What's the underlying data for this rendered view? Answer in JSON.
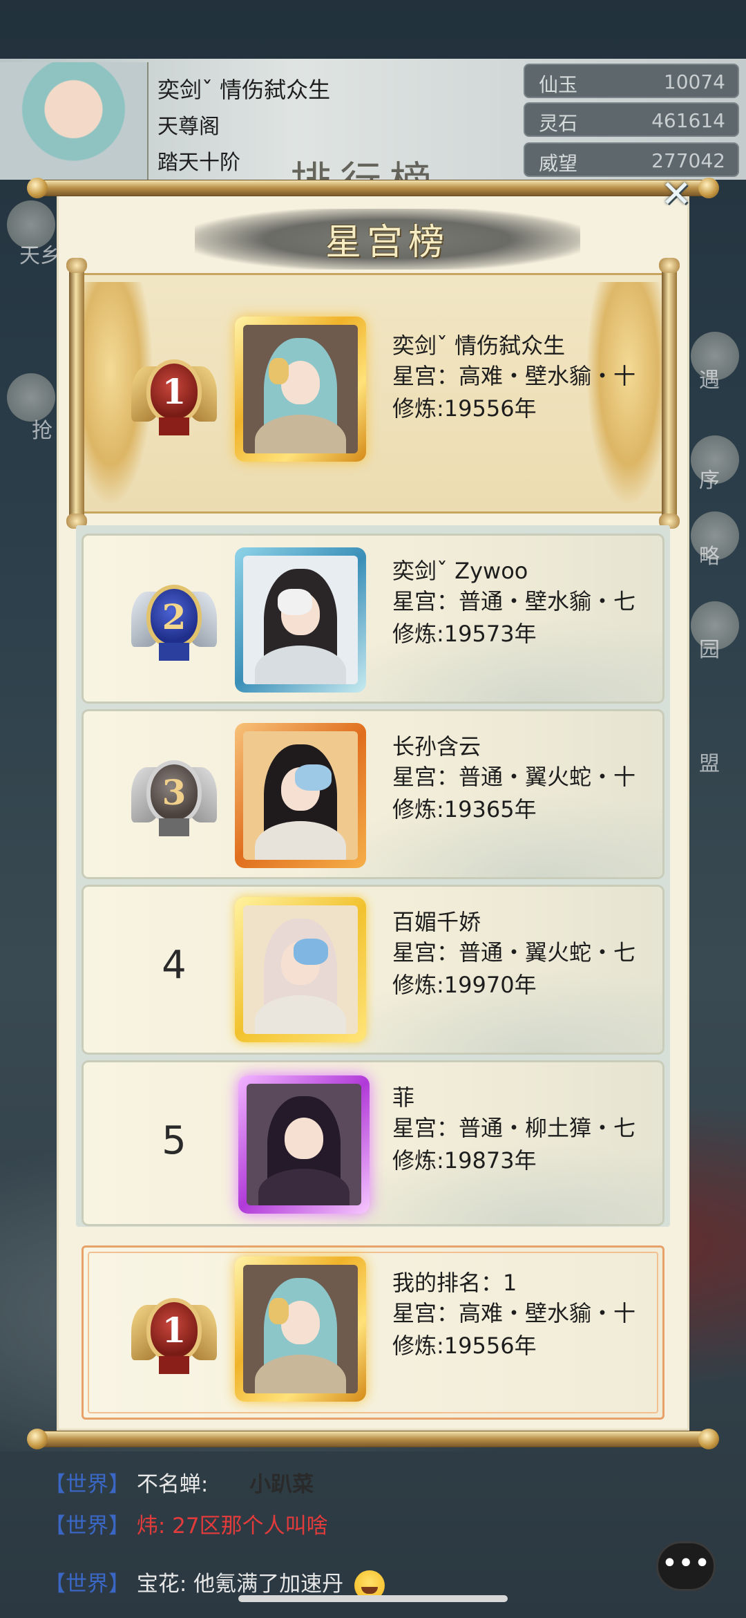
{
  "player": {
    "name": "奕剑ˇ 情伤弑众生",
    "sect": "天尊阁",
    "realm": "踏天十阶"
  },
  "resources": [
    {
      "label": "仙玉",
      "value": "10074"
    },
    {
      "label": "灵石",
      "value": "461614"
    },
    {
      "label": "威望",
      "value": "277042"
    }
  ],
  "background": {
    "title": "排行榜",
    "side_left": [
      "天乡",
      "抢"
    ],
    "side_right": [
      "遇",
      "序",
      "略",
      "园",
      "盟"
    ]
  },
  "popup": {
    "title": "星宫榜",
    "close_label": "✕"
  },
  "rankings": [
    {
      "rank": "1",
      "name": "奕剑ˇ 情伤弑众生",
      "star_palace": "星宫：高难・壁水貐・十",
      "cultivation": "修炼:19556年"
    },
    {
      "rank": "2",
      "name": "奕剑ˇ Zywoo",
      "star_palace": "星宫：普通・壁水貐・七",
      "cultivation": "修炼:19573年"
    },
    {
      "rank": "3",
      "name": "长孙含云",
      "star_palace": "星宫：普通・翼火蛇・十",
      "cultivation": "修炼:19365年"
    },
    {
      "rank": "4",
      "name": "百媚千娇",
      "star_palace": "星宫：普通・翼火蛇・七",
      "cultivation": "修炼:19970年"
    },
    {
      "rank": "5",
      "name": "菲",
      "star_palace": "星宫：普通・柳土獐・七",
      "cultivation": "修炼:19873年"
    }
  ],
  "my_rank": {
    "rank": "1",
    "label": "我的排名：1",
    "star_palace": "星宫：高难・壁水貐・十",
    "cultivation": "修炼:19556年"
  },
  "chat": [
    {
      "tag": "【世界】",
      "speaker": "不名蝉:",
      "message": "小趴菜",
      "speaker_color": "#e8e8e8"
    },
    {
      "tag": "【世界】",
      "speaker": "炜:",
      "message": "27区那个人叫啥",
      "speaker_color": "#e23b3b"
    },
    {
      "tag": "【世界】",
      "speaker": "宝花:",
      "message": "他氪满了加速丹",
      "speaker_color": "#e8e8e8"
    }
  ],
  "chat_button_icon": "more-dots-icon",
  "colors": {
    "gold": "#d9a441",
    "silver": "#9fa7b0",
    "rank2_blue": "#2b3f9e",
    "rank1_red": "#8a1f1a",
    "chat_tag": "#3a66c4"
  }
}
